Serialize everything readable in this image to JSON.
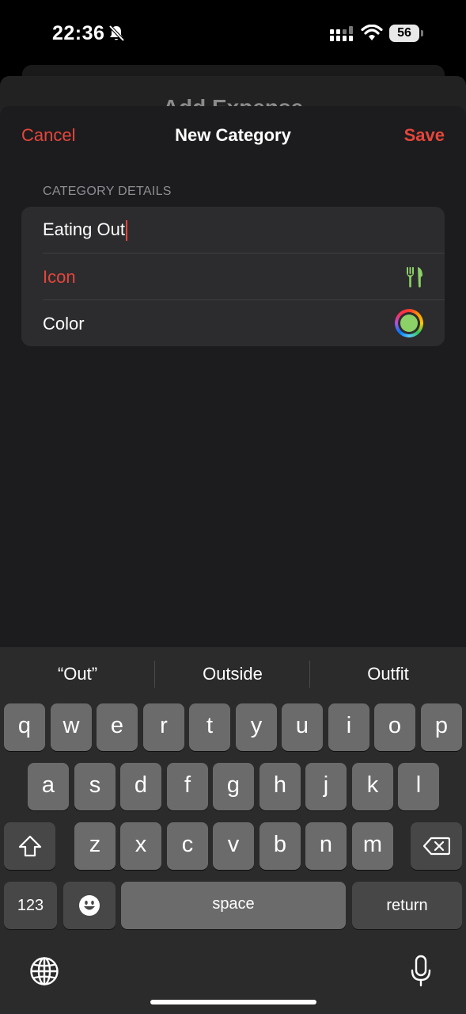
{
  "status_bar": {
    "time": "22:36",
    "battery": "56"
  },
  "behind_sheet": {
    "title": "Add Expense"
  },
  "nav": {
    "cancel_label": "Cancel",
    "title": "New Category",
    "save_label": "Save"
  },
  "section": {
    "header": "CATEGORY DETAILS"
  },
  "form": {
    "name_value": "Eating Out",
    "icon_label": "Icon",
    "icon_name": "fork-knife-icon",
    "color_label": "Color",
    "selected_color": "#8cd068"
  },
  "colors": {
    "accent": "#e5463b",
    "icon_green": "#8cd068"
  },
  "keyboard": {
    "suggestions": [
      "“Out”",
      "Outside",
      "Outfit"
    ],
    "row1": [
      "q",
      "w",
      "e",
      "r",
      "t",
      "y",
      "u",
      "i",
      "o",
      "p"
    ],
    "row2": [
      "a",
      "s",
      "d",
      "f",
      "g",
      "h",
      "j",
      "k",
      "l"
    ],
    "row3": [
      "z",
      "x",
      "c",
      "v",
      "b",
      "n",
      "m"
    ],
    "numbers_label": "123",
    "space_label": "space",
    "return_label": "return"
  }
}
